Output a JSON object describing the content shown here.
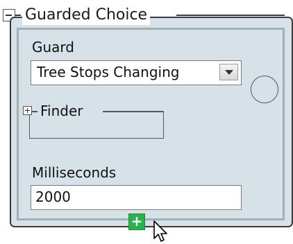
{
  "panel": {
    "title": "Guarded Choice",
    "guard_label": "Guard",
    "guard_value": "Tree Stops Changing",
    "finder_label": "Finder",
    "ms_label": "Milliseconds",
    "ms_value": "2000",
    "add_label": "+"
  },
  "icons": {
    "collapse": "collapse-minus-icon",
    "expand": "expand-plus-icon",
    "dropdown": "dropdown-arrow-icon",
    "cursor": "mouse-cursor-icon"
  },
  "colors": {
    "panel_bg": "#d6e1e8",
    "add_button": "#2bb24c"
  }
}
